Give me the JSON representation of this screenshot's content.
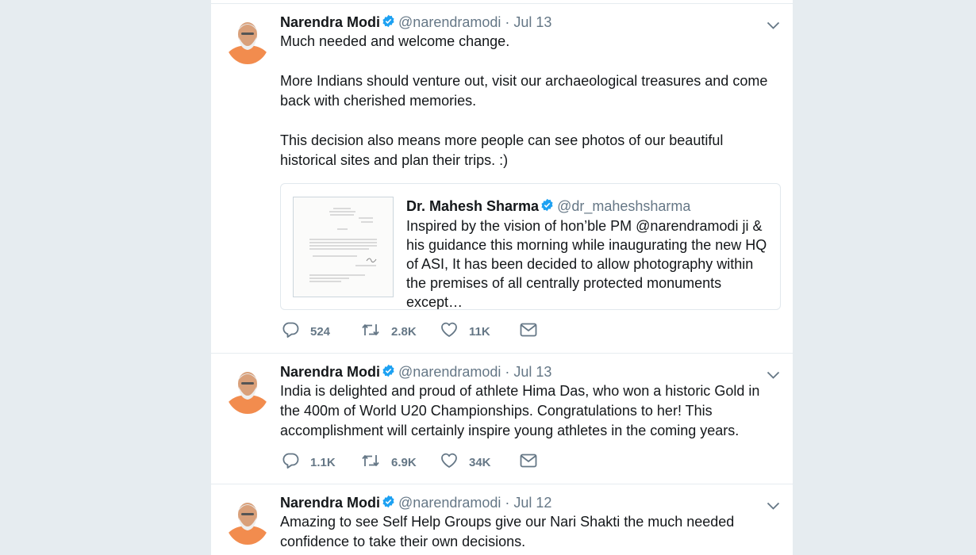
{
  "colors": {
    "link": "#1da1f2",
    "muted": "#657786",
    "skin": "#f28c4e"
  },
  "tweets": [
    {
      "name": "Narendra Modi",
      "handle": "@narendramodi",
      "dot": "·",
      "date": "Jul 13",
      "text": "Much needed and welcome change.\n\nMore Indians should venture out, visit our archaeological treasures and come back with cherished memories.\n\nThis decision also means more people can see photos of our beautiful historical sites and plan their trips. :)",
      "quote": {
        "name": "Dr. Mahesh Sharma",
        "handle": "@dr_maheshsharma",
        "text": "Inspired by the vision of hon’ble PM @narendramodi ji & his guidance this morning while inaugurating the new HQ of ASI, It has been decided to allow photography within the premises of all centrally protected monuments except…"
      },
      "replies": "524",
      "retweets": "2.8K",
      "likes": "11K"
    },
    {
      "name": "Narendra Modi",
      "handle": "@narendramodi",
      "dot": "·",
      "date": "Jul 13",
      "text": "India is delighted and proud of athlete Hima Das, who won a historic Gold in the 400m of World U20 Championships. Congratulations to her! This accomplishment will certainly inspire young athletes in the coming years.",
      "replies": "1.1K",
      "retweets": "6.9K",
      "likes": "34K"
    },
    {
      "name": "Narendra Modi",
      "handle": "@narendramodi",
      "dot": "·",
      "date": "Jul 12",
      "text": "Amazing to see Self Help Groups give our Nari Shakti the much needed confidence to take their own decisions."
    }
  ]
}
